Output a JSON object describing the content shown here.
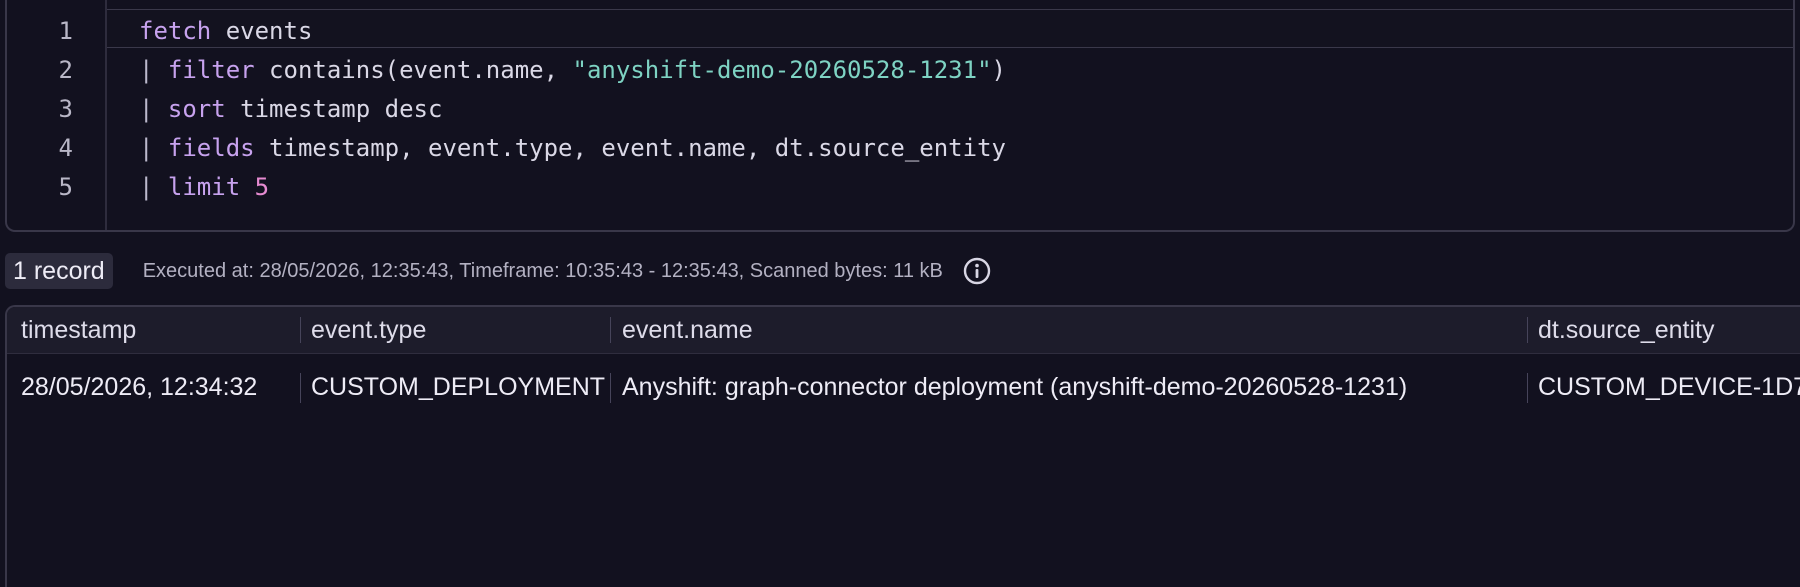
{
  "editor": {
    "lines": [
      {
        "number": "1",
        "parts": [
          {
            "t": "fetch",
            "c": "kw"
          },
          {
            "t": " events",
            "c": ""
          }
        ]
      },
      {
        "number": "2",
        "parts": [
          {
            "t": "| ",
            "c": "pipe"
          },
          {
            "t": "filter",
            "c": "kw"
          },
          {
            "t": " contains(event.name, ",
            "c": ""
          },
          {
            "t": "\"anyshift-demo-20260528-1231\"",
            "c": "str"
          },
          {
            "t": ")",
            "c": ""
          }
        ]
      },
      {
        "number": "3",
        "parts": [
          {
            "t": "| ",
            "c": "pipe"
          },
          {
            "t": "sort",
            "c": "kw"
          },
          {
            "t": " timestamp desc",
            "c": ""
          }
        ]
      },
      {
        "number": "4",
        "parts": [
          {
            "t": "| ",
            "c": "pipe"
          },
          {
            "t": "fields",
            "c": "kw"
          },
          {
            "t": " timestamp, event.type, event.name, dt.source_entity",
            "c": ""
          }
        ]
      },
      {
        "number": "5",
        "parts": [
          {
            "t": "| ",
            "c": "pipe"
          },
          {
            "t": "limit",
            "c": "kw"
          },
          {
            "t": " ",
            "c": ""
          },
          {
            "t": "5",
            "c": "num"
          }
        ]
      }
    ]
  },
  "status": {
    "record_count": "1 record",
    "executed_info": "Executed at: 28/05/2026, 12:35:43, Timeframe: 10:35:43 - 12:35:43, Scanned bytes: 11 kB",
    "info_icon": "info-circle-icon"
  },
  "table": {
    "columns": [
      "timestamp",
      "event.type",
      "event.name",
      "dt.source_entity"
    ],
    "rows": [
      [
        "28/05/2026, 12:34:32",
        "CUSTOM_DEPLOYMENT",
        "Anyshift: graph-connector deployment (anyshift-demo-20260528-1231)",
        "CUSTOM_DEVICE-1D7"
      ]
    ]
  },
  "colors": {
    "background": "#12111f",
    "keyword": "#c7a2ee",
    "string": "#7ed3c3",
    "number": "#e68bd1"
  }
}
